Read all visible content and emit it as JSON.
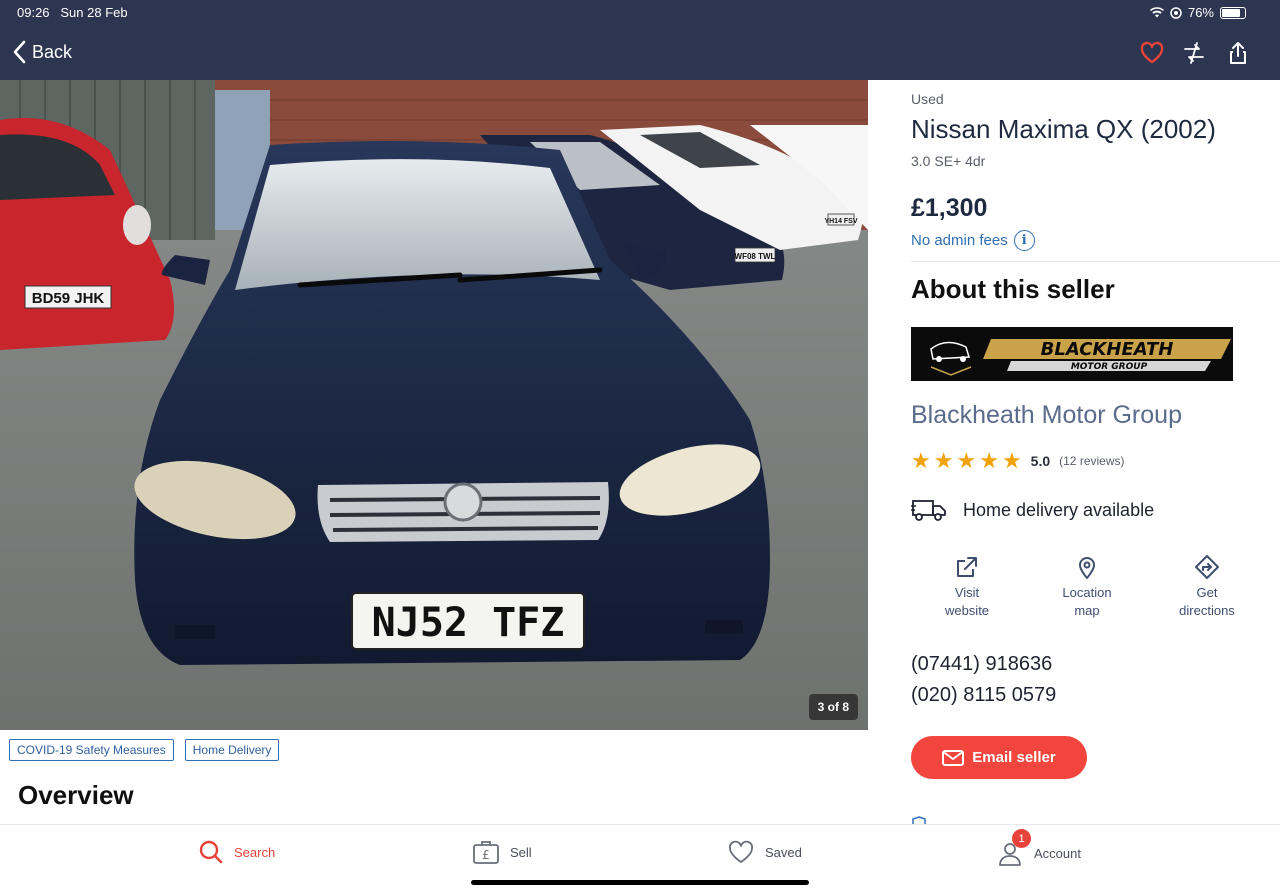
{
  "status": {
    "time": "09:26",
    "date": "Sun 28 Feb",
    "battery": "76%"
  },
  "nav": {
    "back_label": "Back"
  },
  "gallery": {
    "counter": "3 of 8",
    "plate": "NJ52 TFZ",
    "plate_left": "BD59 JHK",
    "plate_mid": "WF08 TWL",
    "plate_right": "YH14 FSV"
  },
  "tags": [
    "COVID-19 Safety Measures",
    "Home Delivery"
  ],
  "overview_heading": "Overview",
  "listing": {
    "condition": "Used",
    "title": "Nissan Maxima QX (2002)",
    "subtitle": "3.0 SE+ 4dr",
    "price": "£1,300",
    "admin_fees": "No admin fees",
    "info_glyph": "i"
  },
  "seller": {
    "heading": "About this seller",
    "logo_text": "BLACKHEATH",
    "logo_subtext": "MOTOR GROUP",
    "name": "Blackheath Motor Group",
    "stars": 5,
    "score": "5.0",
    "reviews": "(12 reviews)",
    "delivery": "Home delivery available",
    "actions": {
      "visit": [
        "Visit",
        "website"
      ],
      "location": [
        "Location",
        "map"
      ],
      "directions": [
        "Get",
        "directions"
      ]
    },
    "phones": [
      "(07441) 918636",
      "(020) 8115 0579"
    ],
    "email_label": "Email seller"
  },
  "tabbar": {
    "search": "Search",
    "sell": "Sell",
    "saved": "Saved",
    "account": "Account",
    "account_badge": "1"
  },
  "colors": {
    "header": "#2c3650",
    "accent": "#e8433a",
    "link": "#2f6fb3",
    "star": "#f0a30a"
  },
  "icons": [
    "wifi-icon",
    "location-lock-icon",
    "battery-icon",
    "chevron-left-icon",
    "heart-icon",
    "compare-icon",
    "share-icon",
    "info-icon",
    "truck-icon",
    "external-link-icon",
    "map-pin-icon",
    "directions-icon",
    "envelope-icon",
    "search-icon",
    "sell-icon",
    "heart-outline-icon",
    "account-icon"
  ]
}
